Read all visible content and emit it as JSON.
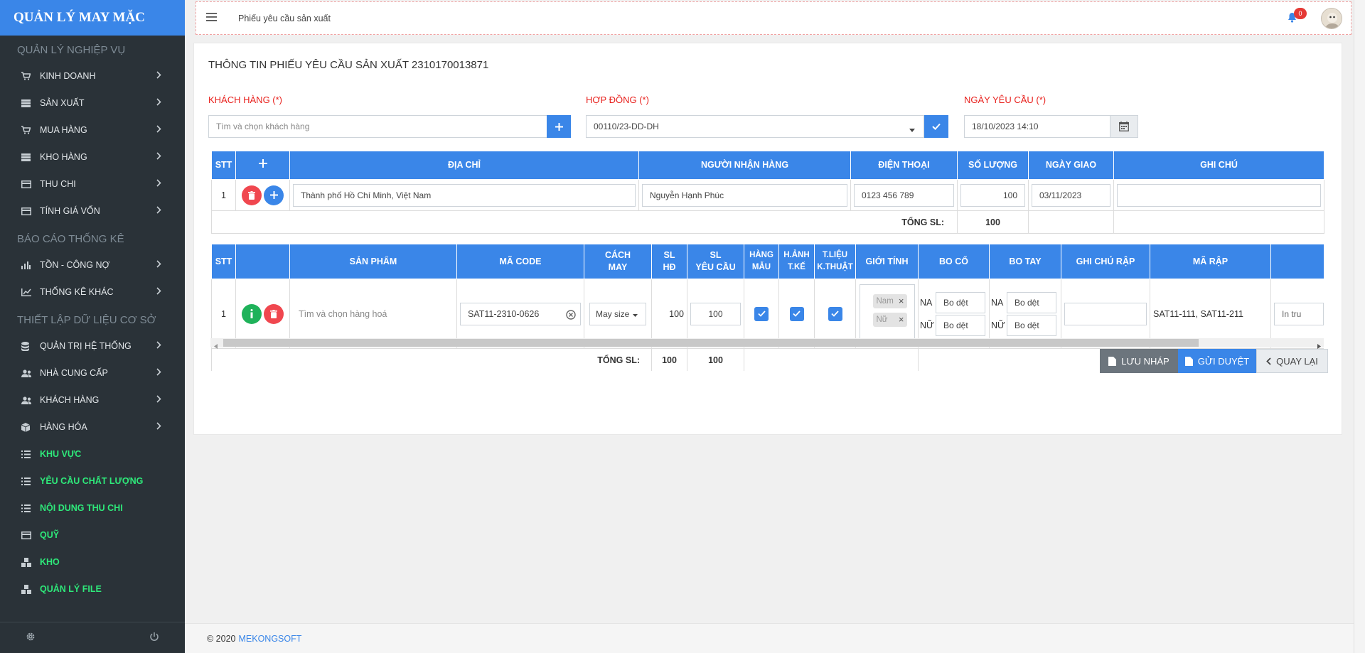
{
  "sidebar": {
    "brand": "QUẢN LÝ MAY MẶC",
    "section1": "QUẢN LÝ NGHIỆP VỤ",
    "nv": [
      "KINH DOANH",
      "SẢN XUẤT",
      "MUA HÀNG",
      "KHO HÀNG",
      "THU CHI",
      "TÍNH GIÁ VỐN"
    ],
    "section2": "BÁO CÁO THỐNG KÊ",
    "bc": [
      "TỒN - CÔNG NỢ",
      "THỐNG KÊ KHÁC"
    ],
    "section3": "THIẾT LẬP DỮ LIỆU CƠ SỞ",
    "tl": [
      "QUẢN TRỊ HỆ THỐNG",
      "NHÀ CUNG CẤP",
      "KHÁCH HÀNG",
      "HÀNG HÓA"
    ],
    "green": [
      "KHU VỰC",
      "YÊU CẦU CHẤT LƯỢNG",
      "NỘI DUNG THU CHI",
      "QUỸ",
      "KHO",
      "QUẢN LÝ FILE"
    ]
  },
  "topbar": {
    "title": "Phiếu yêu cầu sản xuất",
    "notifications": "0"
  },
  "form": {
    "title": "THÔNG TIN PHIẾU YÊU CẦU SẢN XUẤT 2310170013871",
    "customer_label": "KHÁCH HÀNG (*)",
    "customer_placeholder": "Tìm và chọn khách hàng",
    "contract_label": "HỢP ĐỒNG (*)",
    "contract_value": "00110/23-DD-DH",
    "date_label": "NGÀY YÊU CẦU (*)",
    "date_value": "18/10/2023 14:10"
  },
  "delivery": {
    "headers": {
      "stt": "STT",
      "address": "ĐỊA CHỈ",
      "receiver": "NGƯỜI NHẬN HÀNG",
      "phone": "ĐIỆN THOẠI",
      "qty": "SỐ LƯỢNG",
      "date": "NGÀY GIAO",
      "note": "GHI CHÚ"
    },
    "row": {
      "stt": "1",
      "address": "Thành phố Hồ Chí Minh, Việt Nam",
      "receiver": "Nguyễn Hạnh Phúc",
      "phone": "0123 456 789",
      "qty": "100",
      "date": "03/11/2023",
      "note": ""
    },
    "total_label": "TỔNG SL:",
    "total_value": "100"
  },
  "products": {
    "headers": {
      "stt": "STT",
      "product": "SẢN PHẨM",
      "code": "MÃ CODE",
      "sew1": "CÁCH",
      "sew2": "MAY",
      "slhd1": "SL",
      "slhd2": "HĐ",
      "slyc1": "SL",
      "slyc2": "YÊU CẦU",
      "sample1": "HÀNG",
      "sample2": "MẪU",
      "design1": "H.ẢNH",
      "design2": "T.KẾ",
      "tech1": "T.LIỆU",
      "tech2": "K.THUẬT",
      "gender": "GIỚI TÍNH",
      "collar": "BO CỔ",
      "sleeve": "BO TAY",
      "note": "GHI CHÚ RẬP",
      "pattern": "MÃ RẬP"
    },
    "row": {
      "stt": "1",
      "product_placeholder": "Tìm và chọn hàng hoá",
      "code": "SAT11-2310-0626",
      "sew": "May size",
      "slhd": "100",
      "slyc": "100",
      "gender_tags": [
        "Nam",
        "Nữ"
      ],
      "collar_na_label": "NA",
      "collar_na": "Bo dệt",
      "collar_nu_label": "NỮ",
      "collar_nu": "Bo dệt",
      "sleeve_na_label": "NA",
      "sleeve_na": "Bo dệt",
      "sleeve_nu_label": "NỮ",
      "sleeve_nu": "Bo dệt",
      "pattern": "SAT11-111, SAT11-211",
      "extra": "In tru"
    },
    "total_label": "TỔNG SL:",
    "total_hd": "100",
    "total_yc": "100"
  },
  "actions": {
    "draft": "LƯU NHÁP",
    "submit": "GỬI DUYỆT",
    "back": "QUAY LẠI"
  },
  "footer": {
    "copyright": "© 2020",
    "company": "MEKONGSOFT"
  }
}
